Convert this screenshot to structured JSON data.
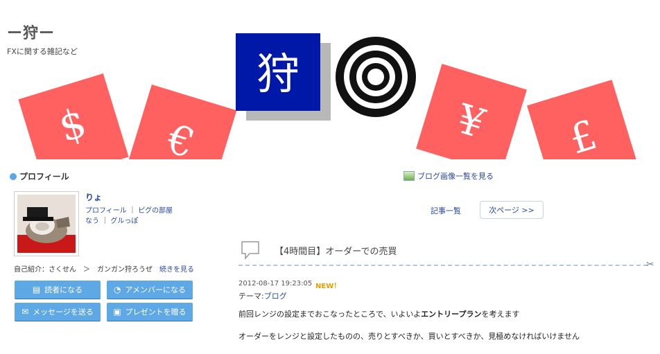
{
  "blog": {
    "title": "ー狩ー",
    "description": "FXに関する雑記など"
  },
  "header": {
    "kanji": "狩",
    "currency_symbols": [
      "$",
      "€",
      "¥",
      "£"
    ],
    "colors": {
      "card_red": "#ff6060",
      "kanji_bg": "#0018a8",
      "shadow": "#b8b8b8"
    }
  },
  "profile": {
    "section_title": "プロフィール",
    "user_name": "りょ",
    "link_profile": "プロフィール",
    "link_room": "ピグの部屋",
    "link_now": "なう",
    "link_gurupo": "グルっぽ",
    "self_intro": "自己紹介：さくせん　＞　ガンガン狩ろうぜ",
    "read_more": "続きを見る",
    "buttons": {
      "reader": "読者になる",
      "amember": "アメンバーになる",
      "message": "メッセージを送る",
      "present": "プレゼントを贈る"
    },
    "colors": {
      "button": "#5ea8e6",
      "accent_dot": "#5aa6e8"
    }
  },
  "nav": {
    "image_list": "ブログ画像一覧を見る",
    "entry_list": "記事一覧",
    "next_page": "次ページ >>"
  },
  "post": {
    "title": "【4時間目】オーダーでの売買",
    "datetime": "2012-08-17 19:23:05",
    "new_badge": "NEW！",
    "theme_label": "テーマ:",
    "theme_value": "ブログ",
    "p1_before": "前回レンジの設定までおこなったところで、いよいよ",
    "p1_bold": "エントリープラン",
    "p1_after": "を考えます",
    "p2": "オーダーをレンジと設定したものの、売りとすべきか、買いとすべきか、見極めなければいけません"
  }
}
